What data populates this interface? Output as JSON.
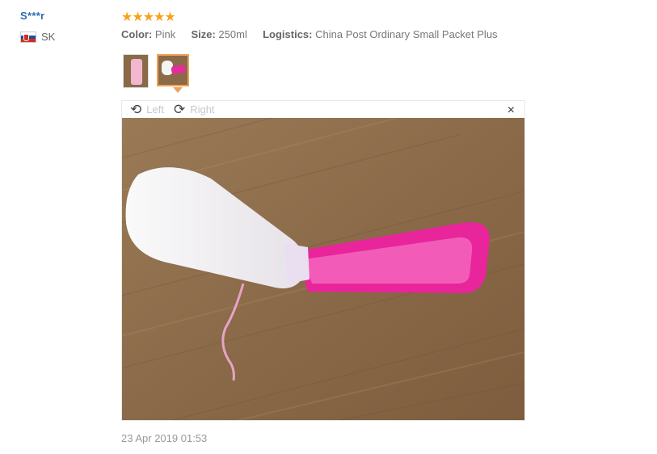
{
  "review": {
    "user": "S***r",
    "country": "SK",
    "stars": "★★★★★",
    "attributes": [
      {
        "key": "Color:",
        "value": "Pink"
      },
      {
        "key": "Size:",
        "value": "250ml"
      },
      {
        "key": "Logistics:",
        "value": "China Post Ordinary Small Packet Plus"
      }
    ],
    "date": "23 Apr 2019 01:53"
  },
  "viewer": {
    "rotate_left": "Left",
    "rotate_right": "Right",
    "close": "×"
  },
  "colors": {
    "star": "#f7a21b",
    "username": "#2a6db0",
    "active_thumb_border": "#f0a05a"
  }
}
